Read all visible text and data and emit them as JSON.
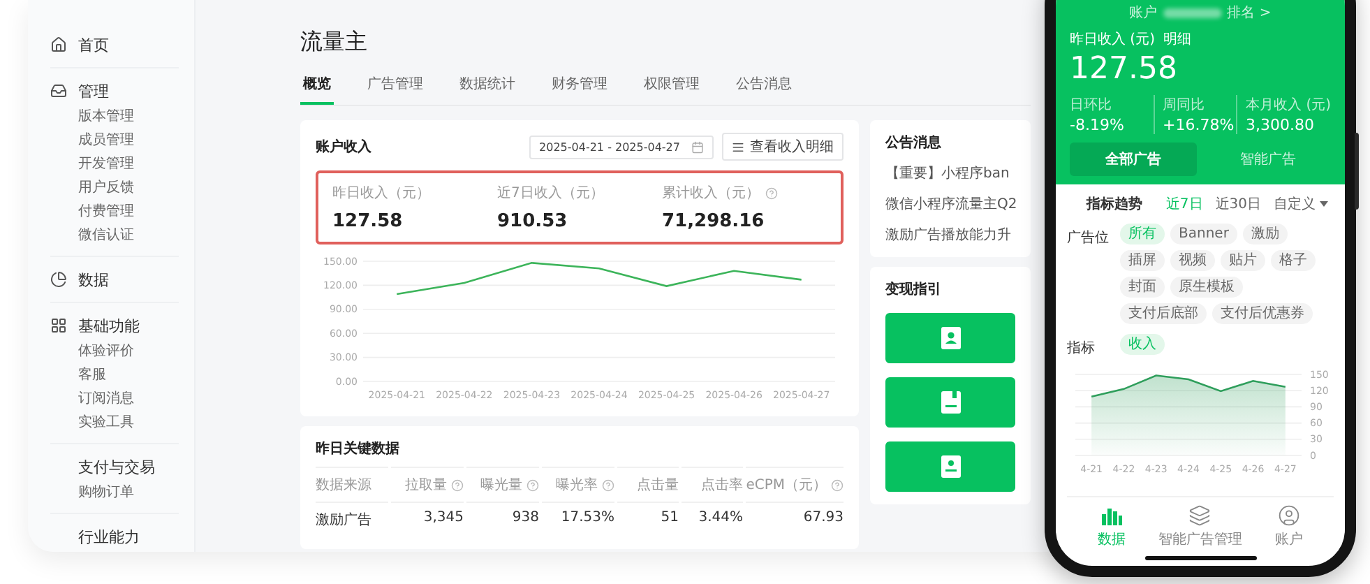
{
  "sidebar": {
    "sections": [
      {
        "label": "首页"
      },
      {
        "label": "管理",
        "children": [
          "版本管理",
          "成员管理",
          "开发管理",
          "用户反馈",
          "付费管理",
          "微信认证"
        ]
      },
      {
        "label": "数据"
      },
      {
        "label": "基础功能",
        "children": [
          "体验评价",
          "客服",
          "订阅消息",
          "实验工具"
        ]
      },
      {
        "label": "支付与交易",
        "children": [
          "购物订单"
        ]
      },
      {
        "label": "行业能力"
      }
    ]
  },
  "page_title": "流量主",
  "tabs": [
    {
      "label": "概览",
      "selected": true
    },
    {
      "label": "广告管理",
      "selected": false
    },
    {
      "label": "数据统计",
      "selected": false
    },
    {
      "label": "财务管理",
      "selected": false
    },
    {
      "label": "权限管理",
      "selected": false
    },
    {
      "label": "公告消息",
      "selected": false
    }
  ],
  "account_income": {
    "title": "账户收入",
    "date_range": "2025-04-21 - 2025-04-27",
    "detail_button": "查看收入明细",
    "highlighted": true,
    "stats": [
      {
        "label": "昨日收入（元）",
        "value": "127.58",
        "help": false
      },
      {
        "label": "近7日收入（元）",
        "value": "910.53",
        "help": false
      },
      {
        "label": "累计收入（元）",
        "value": "71,298.16",
        "help": true
      }
    ],
    "chart_data": {
      "type": "line",
      "categories": [
        "2025-04-21",
        "2025-04-22",
        "2025-04-23",
        "2025-04-24",
        "2025-04-25",
        "2025-04-26",
        "2025-04-27"
      ],
      "series": [
        {
          "color": "#3cb45a",
          "values": [
            109,
            123,
            148,
            141,
            119,
            138,
            127
          ]
        }
      ],
      "grid": true,
      "ylim": [
        0,
        150
      ],
      "yticks": [
        {
          "value": 0,
          "label": "0.00"
        },
        {
          "value": 30,
          "label": "30.00"
        },
        {
          "value": 60,
          "label": "60.00"
        },
        {
          "value": 90,
          "label": "90.00"
        },
        {
          "value": 120,
          "label": "120.00"
        },
        {
          "value": 150,
          "label": "150.00"
        }
      ]
    }
  },
  "key_data": {
    "title": "昨日关键数据",
    "columns": [
      {
        "label": "数据来源",
        "help": false
      },
      {
        "label": "拉取量",
        "help": true
      },
      {
        "label": "曝光量",
        "help": true
      },
      {
        "label": "曝光率",
        "help": true
      },
      {
        "label": "点击量",
        "help": false
      },
      {
        "label": "点击率",
        "help": false
      },
      {
        "label": "eCPM（元）",
        "help": true
      }
    ],
    "rows": [
      [
        "激励广告",
        "3,345",
        "938",
        "17.53%",
        "51",
        "3.44%",
        "67.93"
      ]
    ]
  },
  "announcements": {
    "title": "公告消息",
    "items": [
      "【重要】小程序ban",
      "微信小程序流量主Q2",
      "激励广告播放能力升"
    ]
  },
  "guide": {
    "title": "变现指引"
  },
  "phone": {
    "account_label": "账户",
    "account_link": "排名 >",
    "income_title": "昨日收入 (元)",
    "income_link": "明细",
    "income_value": "127.58",
    "stats": [
      {
        "label": "日环比",
        "value": "-8.19%"
      },
      {
        "label": "周同比",
        "value": "+16.78%"
      },
      {
        "label": "本月收入 (元)",
        "value": "3,300.80"
      }
    ],
    "ad_tabs": [
      {
        "label": "全部广告",
        "selected": true
      },
      {
        "label": "智能广告",
        "selected": false
      }
    ],
    "trend_title": "指标趋势",
    "ranges": [
      {
        "label": "近7日",
        "selected": true,
        "dropdown": false
      },
      {
        "label": "近30日",
        "selected": false,
        "dropdown": false
      },
      {
        "label": "自定义",
        "selected": false,
        "dropdown": true
      }
    ],
    "slot_label": "广告位",
    "slots": [
      {
        "label": "所有",
        "selected": true
      },
      {
        "label": "Banner",
        "selected": false
      },
      {
        "label": "激励",
        "selected": false
      },
      {
        "label": "插屏",
        "selected": false
      },
      {
        "label": "视频",
        "selected": false
      },
      {
        "label": "贴片",
        "selected": false
      },
      {
        "label": "格子",
        "selected": false
      },
      {
        "label": "封面",
        "selected": false
      },
      {
        "label": "原生模板",
        "selected": false
      },
      {
        "label": "支付后底部",
        "selected": false
      },
      {
        "label": "支付后优惠券",
        "selected": false
      }
    ],
    "metric_label": "指标",
    "metrics": [
      {
        "label": "收入",
        "selected": true
      }
    ],
    "chart_data": {
      "type": "area",
      "categories": [
        "4-21",
        "4-22",
        "4-23",
        "4-24",
        "4-25",
        "4-26",
        "4-27"
      ],
      "series": [
        {
          "color": "#2e9e5b",
          "values": [
            109,
            123,
            148,
            141,
            119,
            138,
            127
          ]
        }
      ],
      "grid": true,
      "ylim": [
        0,
        150
      ],
      "yticks": [
        0,
        30,
        60,
        90,
        120,
        150
      ]
    },
    "nav": [
      {
        "label": "数据",
        "selected": true
      },
      {
        "label": "智能广告管理",
        "selected": false
      },
      {
        "label": "账户",
        "selected": false
      }
    ]
  }
}
